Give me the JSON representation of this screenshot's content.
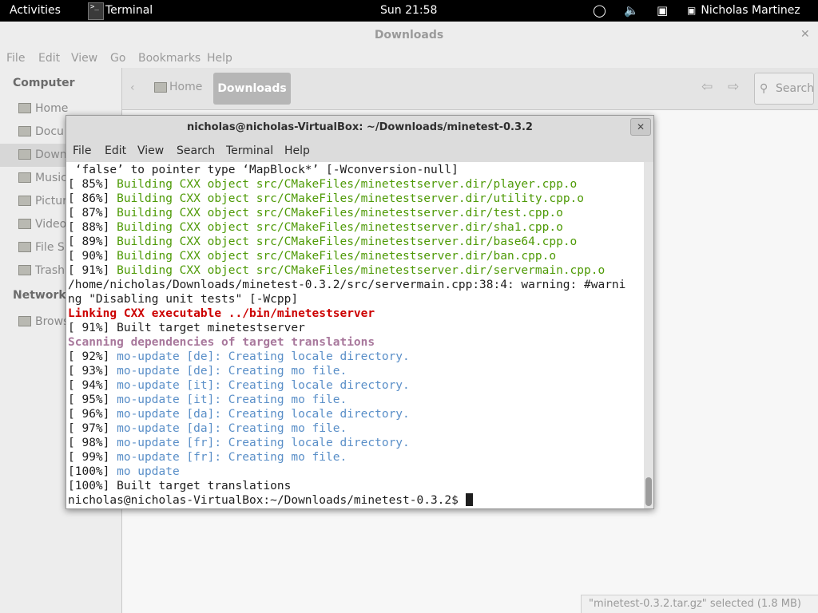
{
  "topbar": {
    "activities": "Activities",
    "app_name": "Terminal",
    "clock": "Sun 21:58",
    "user": "Nicholas Martinez",
    "icons": [
      "accessibility-icon",
      "volume-icon",
      "network-icon",
      "user-status-icon"
    ]
  },
  "nautilus": {
    "title": "Downloads",
    "menu": [
      "File",
      "Edit",
      "View",
      "Go",
      "Bookmarks",
      "Help"
    ],
    "sidebar": {
      "computer_header": "Computer",
      "items": [
        "Home",
        "Docu",
        "Down",
        "Music",
        "Pictur",
        "Video",
        "File S",
        "Trash"
      ],
      "selected_index": 2,
      "network_header": "Network",
      "network_items": [
        "Brows"
      ]
    },
    "toolbar": {
      "home": "Home",
      "current": "Downloads",
      "search": "Search"
    },
    "status": "\"minetest-0.3.2.tar.gz\" selected (1.8 MB)"
  },
  "terminal": {
    "title": "nicholas@nicholas-VirtualBox: ~/Downloads/minetest-0.3.2",
    "menu": [
      "File",
      "Edit",
      "View",
      "Search",
      "Terminal",
      "Help"
    ],
    "colors": {
      "green": "#4e9a06",
      "red": "#cc0000",
      "purple": "#a8789c",
      "blue": "#5a8fc8",
      "text": "#1e1e1e"
    },
    "lines": [
      [
        {
          "t": " ‘false’ to pointer type ‘MapBlock*’ [-Wconversion-null]",
          "c": "text"
        }
      ],
      [
        {
          "t": "[ 85%] ",
          "c": "text"
        },
        {
          "t": "Building CXX object src/CMakeFiles/minetestserver.dir/player.cpp.o",
          "c": "green"
        }
      ],
      [
        {
          "t": "[ 86%] ",
          "c": "text"
        },
        {
          "t": "Building CXX object src/CMakeFiles/minetestserver.dir/utility.cpp.o",
          "c": "green"
        }
      ],
      [
        {
          "t": "[ 87%] ",
          "c": "text"
        },
        {
          "t": "Building CXX object src/CMakeFiles/minetestserver.dir/test.cpp.o",
          "c": "green"
        }
      ],
      [
        {
          "t": "[ 88%] ",
          "c": "text"
        },
        {
          "t": "Building CXX object src/CMakeFiles/minetestserver.dir/sha1.cpp.o",
          "c": "green"
        }
      ],
      [
        {
          "t": "[ 89%] ",
          "c": "text"
        },
        {
          "t": "Building CXX object src/CMakeFiles/minetestserver.dir/base64.cpp.o",
          "c": "green"
        }
      ],
      [
        {
          "t": "[ 90%] ",
          "c": "text"
        },
        {
          "t": "Building CXX object src/CMakeFiles/minetestserver.dir/ban.cpp.o",
          "c": "green"
        }
      ],
      [
        {
          "t": "[ 91%] ",
          "c": "text"
        },
        {
          "t": "Building CXX object src/CMakeFiles/minetestserver.dir/servermain.cpp.o",
          "c": "green"
        }
      ],
      [
        {
          "t": "/home/nicholas/Downloads/minetest-0.3.2/src/servermain.cpp:38:4: warning: #warni",
          "c": "text"
        }
      ],
      [
        {
          "t": "ng \"Disabling unit tests\" [-Wcpp]",
          "c": "text"
        }
      ],
      [
        {
          "t": "Linking CXX executable ../bin/minetestserver",
          "c": "red",
          "b": true
        }
      ],
      [
        {
          "t": "[ 91%] Built target minetestserver",
          "c": "text"
        }
      ],
      [
        {
          "t": "Scanning dependencies of target translations",
          "c": "purple",
          "b": true
        }
      ],
      [
        {
          "t": "[ 92%] ",
          "c": "text"
        },
        {
          "t": "mo-update [de]: Creating locale directory.",
          "c": "blue"
        }
      ],
      [
        {
          "t": "[ 93%] ",
          "c": "text"
        },
        {
          "t": "mo-update [de]: Creating mo file.",
          "c": "blue"
        }
      ],
      [
        {
          "t": "[ 94%] ",
          "c": "text"
        },
        {
          "t": "mo-update [it]: Creating locale directory.",
          "c": "blue"
        }
      ],
      [
        {
          "t": "[ 95%] ",
          "c": "text"
        },
        {
          "t": "mo-update [it]: Creating mo file.",
          "c": "blue"
        }
      ],
      [
        {
          "t": "[ 96%] ",
          "c": "text"
        },
        {
          "t": "mo-update [da]: Creating locale directory.",
          "c": "blue"
        }
      ],
      [
        {
          "t": "[ 97%] ",
          "c": "text"
        },
        {
          "t": "mo-update [da]: Creating mo file.",
          "c": "blue"
        }
      ],
      [
        {
          "t": "[ 98%] ",
          "c": "text"
        },
        {
          "t": "mo-update [fr]: Creating locale directory.",
          "c": "blue"
        }
      ],
      [
        {
          "t": "[ 99%] ",
          "c": "text"
        },
        {
          "t": "mo-update [fr]: Creating mo file.",
          "c": "blue"
        }
      ],
      [
        {
          "t": "[100%] ",
          "c": "text"
        },
        {
          "t": "mo update",
          "c": "blue"
        }
      ],
      [
        {
          "t": "[100%] Built target translations",
          "c": "text"
        }
      ]
    ],
    "prompt": "nicholas@nicholas-VirtualBox:~/Downloads/minetest-0.3.2$ "
  }
}
